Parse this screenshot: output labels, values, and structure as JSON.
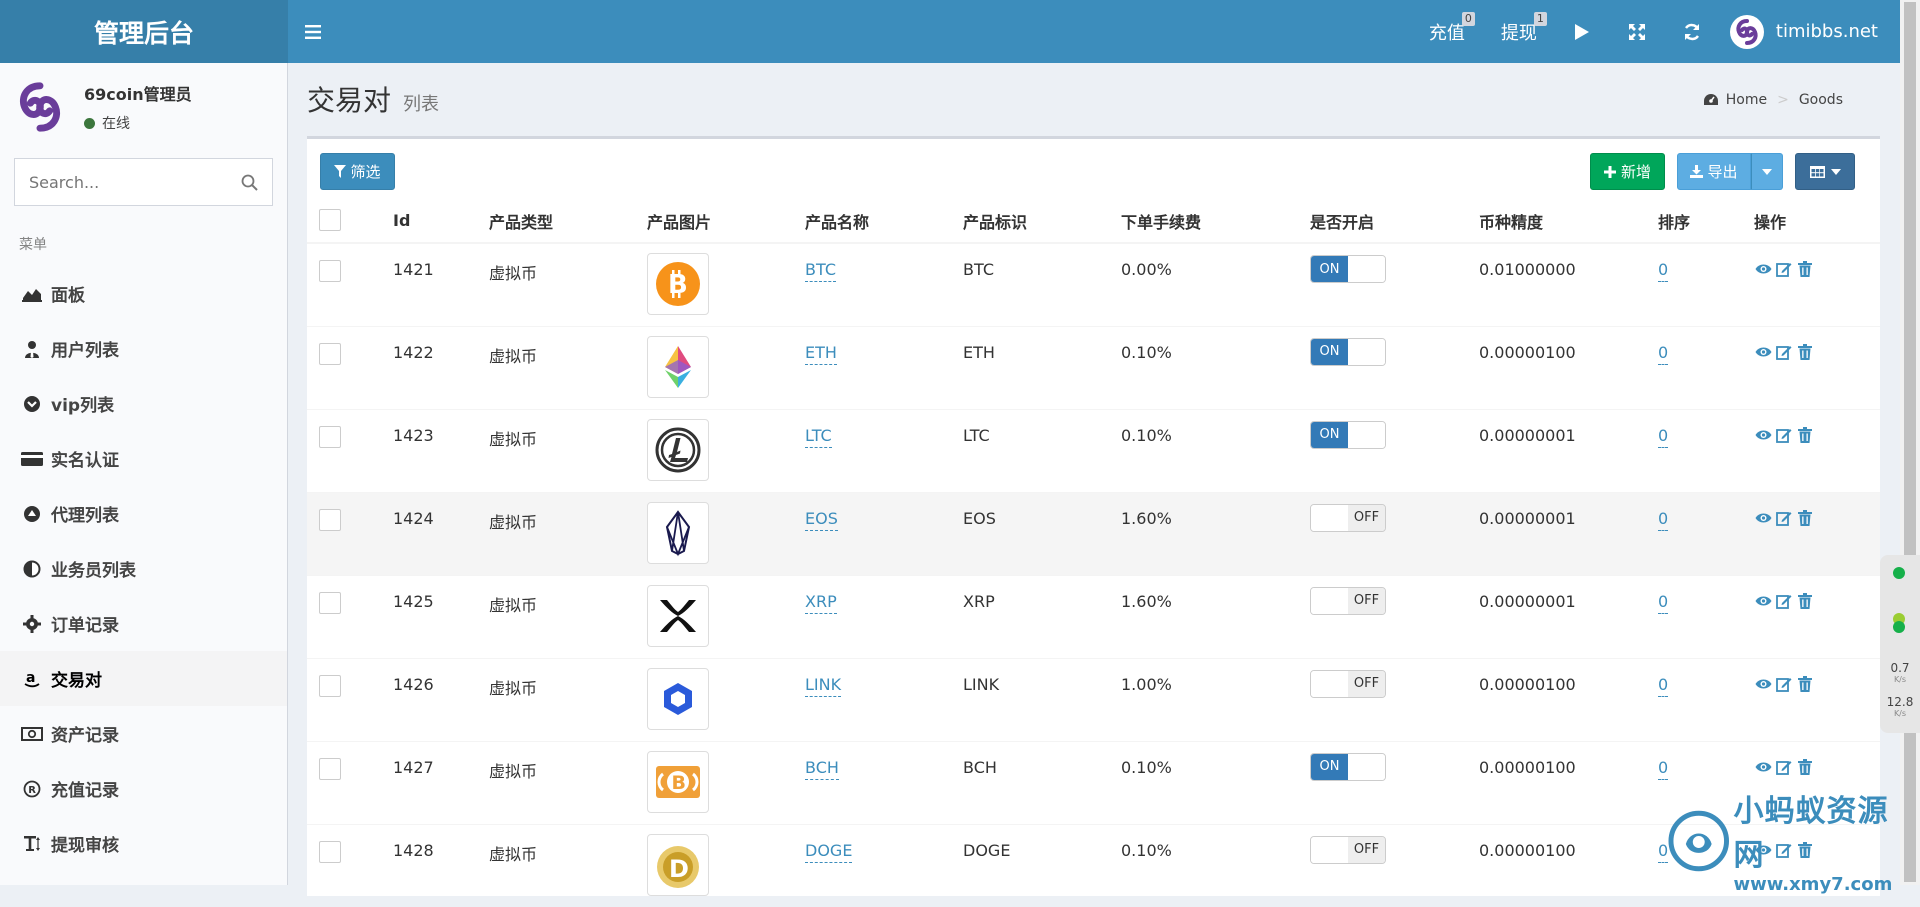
{
  "header": {
    "logo": "管理后台",
    "recharge_label": "充值",
    "recharge_badge": "0",
    "withdraw_label": "提现",
    "withdraw_badge": "1",
    "username": "timibbs.net"
  },
  "sidebar": {
    "user_name": "69coin管理员",
    "user_status": "在线",
    "search_placeholder": "Search...",
    "menu_header": "菜单",
    "items": [
      {
        "label": "面板",
        "icon": "area-chart-icon"
      },
      {
        "label": "用户列表",
        "icon": "user-tie-icon"
      },
      {
        "label": "vip列表",
        "icon": "chevron-circle-icon"
      },
      {
        "label": "实名认证",
        "icon": "credit-card-icon"
      },
      {
        "label": "代理列表",
        "icon": "eject-circle-icon"
      },
      {
        "label": "业务员列表",
        "icon": "half-circle-icon"
      },
      {
        "label": "订单记录",
        "icon": "gear-icon"
      },
      {
        "label": "交易对",
        "icon": "amazon-icon"
      },
      {
        "label": "资产记录",
        "icon": "money-icon"
      },
      {
        "label": "充值记录",
        "icon": "registered-icon"
      },
      {
        "label": "提现审核",
        "icon": "text-height-icon"
      }
    ]
  },
  "content": {
    "title": "交易对",
    "subtitle": "列表",
    "breadcrumb_home": "Home",
    "breadcrumb_current": "Goods",
    "filter_label": "筛选",
    "add_label": "新增",
    "export_label": "导出"
  },
  "table": {
    "headers": [
      "Id",
      "产品类型",
      "产品图片",
      "产品名称",
      "产品标识",
      "下单手续费",
      "是否开启",
      "币种精度",
      "排序",
      "操作"
    ],
    "on_label": "ON",
    "off_label": "OFF",
    "rows": [
      {
        "id": "1421",
        "type": "虚拟币",
        "name": "BTC",
        "symbol": "BTC",
        "fee": "0.00%",
        "enabled": "ON",
        "precision": "0.01000000",
        "sort": "0",
        "icon": "bitcoin-icon"
      },
      {
        "id": "1422",
        "type": "虚拟币",
        "name": "ETH",
        "symbol": "ETH",
        "fee": "0.10%",
        "enabled": "ON",
        "precision": "0.00000100",
        "sort": "0",
        "icon": "ethereum-icon"
      },
      {
        "id": "1423",
        "type": "虚拟币",
        "name": "LTC",
        "symbol": "LTC",
        "fee": "0.10%",
        "enabled": "ON",
        "precision": "0.00000001",
        "sort": "0",
        "icon": "litecoin-icon"
      },
      {
        "id": "1424",
        "type": "虚拟币",
        "name": "EOS",
        "symbol": "EOS",
        "fee": "1.60%",
        "enabled": "OFF",
        "precision": "0.00000001",
        "sort": "0",
        "icon": "eos-icon"
      },
      {
        "id": "1425",
        "type": "虚拟币",
        "name": "XRP",
        "symbol": "XRP",
        "fee": "1.60%",
        "enabled": "OFF",
        "precision": "0.00000001",
        "sort": "0",
        "icon": "xrp-icon"
      },
      {
        "id": "1426",
        "type": "虚拟币",
        "name": "LINK",
        "symbol": "LINK",
        "fee": "1.00%",
        "enabled": "OFF",
        "precision": "0.00000100",
        "sort": "0",
        "icon": "chainlink-icon"
      },
      {
        "id": "1427",
        "type": "虚拟币",
        "name": "BCH",
        "symbol": "BCH",
        "fee": "0.10%",
        "enabled": "ON",
        "precision": "0.00000100",
        "sort": "0",
        "icon": "bitcoin-cash-icon"
      },
      {
        "id": "1428",
        "type": "虚拟币",
        "name": "DOGE",
        "symbol": "DOGE",
        "fee": "0.10%",
        "enabled": "OFF",
        "precision": "0.00000100",
        "sort": "0",
        "icon": "dogecoin-icon"
      }
    ]
  },
  "widget": {
    "upload_speed": "0.7",
    "download_speed": "12.8",
    "speed_unit": "K/s"
  },
  "watermark": {
    "title": "小蚂蚁资源网",
    "url": "www.xmy7.com"
  }
}
